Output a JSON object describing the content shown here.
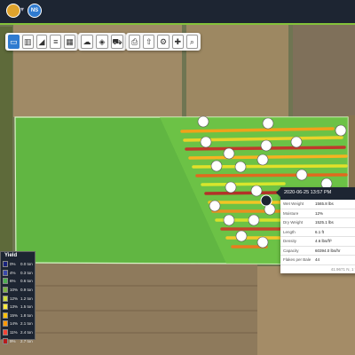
{
  "app": {
    "accent_color": "#84c23a",
    "logo_icon": "farm-logo-icon",
    "badge_text": "NS"
  },
  "toolbar": {
    "groups": [
      [
        "map-view-icon",
        "chart-icon",
        "line-chart-icon",
        "list-icon",
        "calendar-icon"
      ],
      [
        "weather-icon",
        "layers-icon",
        "tractor-icon"
      ],
      [
        "print-icon",
        "upload-icon",
        "settings-icon",
        "crosshair-icon",
        "search-icon"
      ]
    ]
  },
  "legend": {
    "header": "Yield",
    "rows": [
      {
        "color": "#1a237e",
        "pct": "0%",
        "val": "0.0 ton"
      },
      {
        "color": "#3949ab",
        "pct": "4%",
        "val": "0.3 ton"
      },
      {
        "color": "#4caf50",
        "pct": "6%",
        "val": "0.6 ton"
      },
      {
        "color": "#7cb342",
        "pct": "10%",
        "val": "0.9 ton"
      },
      {
        "color": "#cddc39",
        "pct": "12%",
        "val": "1.2 ton"
      },
      {
        "color": "#ffeb3b",
        "pct": "13%",
        "val": "1.5 ton"
      },
      {
        "color": "#ffc107",
        "pct": "15%",
        "val": "1.8 ton"
      },
      {
        "color": "#ff9800",
        "pct": "14%",
        "val": "2.1 ton"
      },
      {
        "color": "#f44336",
        "pct": "11%",
        "val": "2.4 ton"
      },
      {
        "color": "#b71c1c",
        "pct": "9%",
        "val": "2.7 ton"
      }
    ]
  },
  "popup": {
    "title": "2020-06-25 13:57 PM",
    "rows": [
      {
        "k": "Wet Weight",
        "v": "1565.8 lbs"
      },
      {
        "k": "Moisture",
        "v": "12%"
      },
      {
        "k": "Dry Weight",
        "v": "1525.1 lbs"
      },
      {
        "k": "Length",
        "v": "6.1 ft"
      },
      {
        "k": "Density",
        "v": "4.6 lbs/ft³"
      },
      {
        "k": "Capacity",
        "v": "60394.0 lbs/hr"
      },
      {
        "k": "Flakes per Bale",
        "v": "44"
      }
    ],
    "footer": "41.9671 N, 1 W"
  }
}
